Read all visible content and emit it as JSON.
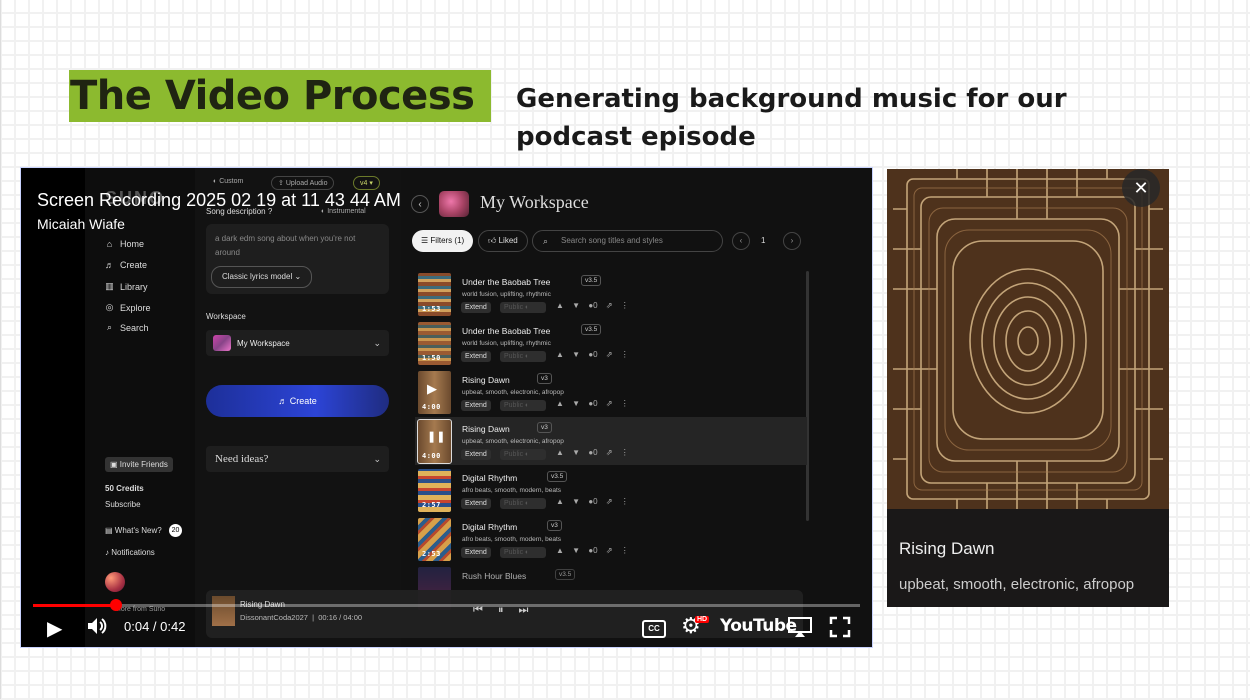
{
  "slide": {
    "title": "The Video Process",
    "subtitle": "Generating background music for our podcast episode",
    "colors": {
      "title_highlight": "#8cba2f",
      "text": "#1a1a1a"
    }
  },
  "video": {
    "title": "Screen Recording 2025 02 19 at 11 43 44 AM",
    "channel": "Micaiah Wiafe",
    "time": "0:04 / 0:42",
    "progress": 0.1,
    "icons": [
      "play-icon",
      "volume-icon",
      "captions-icon",
      "settings-icon",
      "airplay-icon",
      "fullscreen-icon"
    ],
    "cc_label": "CC",
    "hd_label": "HD",
    "youtube_label": "YouTube"
  },
  "suno": {
    "logo": "SUNO",
    "sidebar": [
      {
        "icon": "home-icon",
        "glyph": "⌂",
        "label": "Home"
      },
      {
        "icon": "create-icon",
        "glyph": "♬",
        "label": "Create"
      },
      {
        "icon": "library-icon",
        "glyph": "▥",
        "label": "Library"
      },
      {
        "icon": "explore-icon",
        "glyph": "◎",
        "label": "Explore"
      },
      {
        "icon": "search-icon",
        "glyph": "⌕",
        "label": "Search"
      }
    ],
    "invite": "Invite Friends",
    "credits": "50 Credits",
    "subscribe": "Subscribe",
    "whats_new": "What's New?",
    "whats_new_count": "20",
    "notifications": "Notifications",
    "more_from": "More from Suno",
    "form": {
      "custom": "Custom",
      "upload_audio": "Upload Audio",
      "version": "v4",
      "song_description_label": "Song description",
      "instrumental": "Instrumental",
      "description_value": "a dark edm song about when you're not around",
      "lyrics_model": "Classic lyrics model",
      "workspace_label": "Workspace",
      "workspace_value": "My Workspace",
      "create_label": "Create",
      "ideas_label": "Need ideas?"
    },
    "workspace": {
      "title": "My Workspace",
      "filters_label": "Filters (1)",
      "liked_label": "Liked",
      "search_placeholder": "Search song titles and styles",
      "page": "1",
      "extend_label": "Extend",
      "public_label": "Public",
      "songs": [
        {
          "title": "Under the Baobab Tree",
          "version": "v3.5",
          "tags": "world fusion, uplifting, rhythmic",
          "duration": "1:53",
          "comments": "0"
        },
        {
          "title": "Under the Baobab Tree",
          "version": "v3.5",
          "tags": "world fusion, uplifting, rhythmic",
          "duration": "1:50",
          "comments": "0"
        },
        {
          "title": "Rising Dawn",
          "version": "v3",
          "tags": "upbeat, smooth, electronic, afropop",
          "duration": "4:00",
          "comments": "0"
        },
        {
          "title": "Rising Dawn",
          "version": "v3",
          "tags": "upbeat, smooth, electronic, afropop",
          "duration": "4:00",
          "comments": "0"
        },
        {
          "title": "Digital Rhythm",
          "version": "v3.5",
          "tags": "afro beats, smooth, modern, beats",
          "duration": "2:57",
          "comments": "0"
        },
        {
          "title": "Digital Rhythm",
          "version": "v3",
          "tags": "afro beats, smooth, modern, beats",
          "duration": "2:53",
          "comments": "0"
        },
        {
          "title": "Rush Hour Blues",
          "version": "v3.5",
          "tags": "",
          "duration": "",
          "comments": ""
        }
      ]
    },
    "now_playing": {
      "title": "Rising Dawn",
      "artist": "DissonantCoda2027",
      "time": "00:16 / 04:00"
    }
  },
  "image_card": {
    "title": "Rising Dawn",
    "tags": "upbeat, smooth, electronic, afropop",
    "close_label": "✕"
  }
}
